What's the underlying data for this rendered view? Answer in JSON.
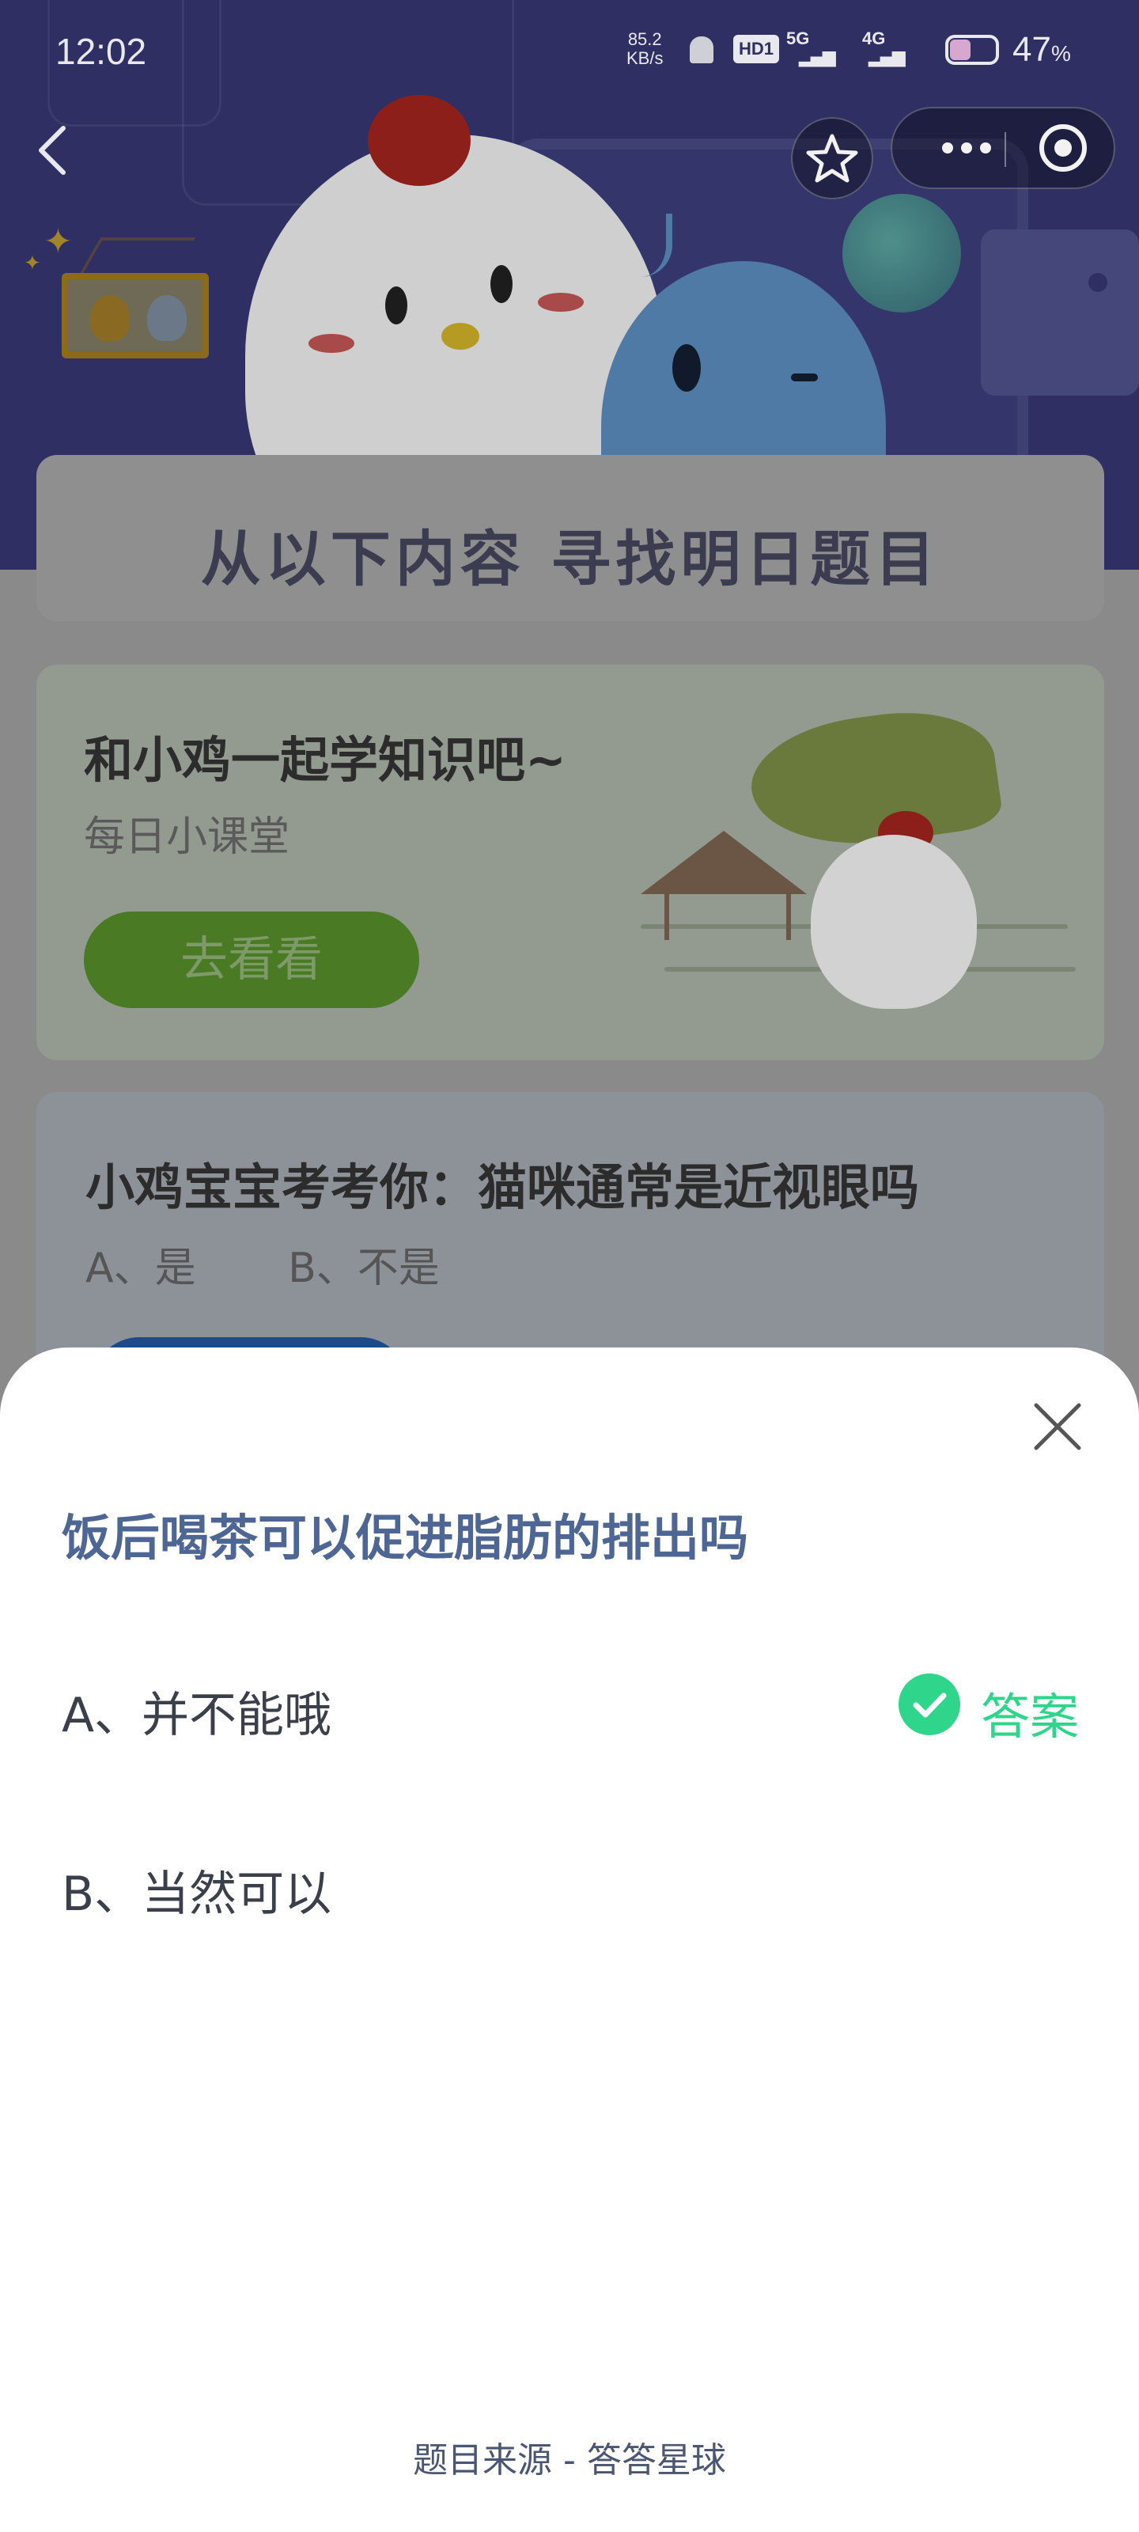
{
  "status_bar": {
    "time": "12:02",
    "net_speed_value": "85.2",
    "net_speed_unit": "KB/s",
    "hd_label": "HD1",
    "net1": "5G",
    "net2": "4G",
    "battery_percent": "47",
    "battery_unit": "%",
    "battery_level": 0.47
  },
  "nav": {
    "back_icon": "chevron-left-icon",
    "favorite_icon": "star-icon",
    "more_icon": "more-dots-icon",
    "close_app_icon": "target-circle-icon"
  },
  "background": {
    "find_title": "从以下内容 寻找明日题目",
    "learn_card": {
      "title": "和小鸡一起学知识吧~",
      "subtitle": "每日小课堂",
      "button": "去看看"
    },
    "quiz_card": {
      "title": "小鸡宝宝考考你：猫咪通常是近视眼吗",
      "option_a": "A、是",
      "option_b": "B、不是"
    }
  },
  "sheet": {
    "close_icon": "close-icon",
    "question": "饭后喝茶可以促进脂肪的排出吗",
    "options": [
      {
        "label": "A、并不能哦",
        "is_answer": true
      },
      {
        "label": "B、当然可以",
        "is_answer": false
      }
    ],
    "answer_label": "答案",
    "source": "题目来源 - 答答星球",
    "colors": {
      "question": "#4e6694",
      "answer": "#2fd58a"
    }
  }
}
